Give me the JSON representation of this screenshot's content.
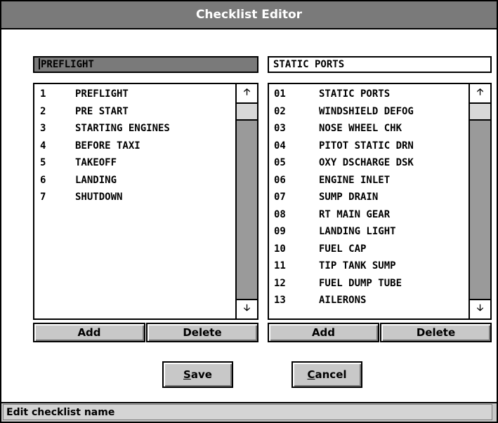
{
  "window": {
    "title": "Checklist Editor"
  },
  "left_panel": {
    "name_value": "PREFLIGHT",
    "items": [
      {
        "num": "1",
        "label": "PREFLIGHT"
      },
      {
        "num": "2",
        "label": "PRE START"
      },
      {
        "num": "3",
        "label": "STARTING ENGINES"
      },
      {
        "num": "4",
        "label": "BEFORE TAXI"
      },
      {
        "num": "5",
        "label": "TAKEOFF"
      },
      {
        "num": "6",
        "label": "LANDING"
      },
      {
        "num": "7",
        "label": "SHUTDOWN"
      }
    ],
    "add_label": "Add",
    "delete_label": "Delete"
  },
  "right_panel": {
    "name_value": "STATIC PORTS",
    "items": [
      {
        "num": "01",
        "label": "STATIC PORTS"
      },
      {
        "num": "02",
        "label": "WINDSHIELD DEFOG"
      },
      {
        "num": "03",
        "label": "NOSE WHEEL CHK"
      },
      {
        "num": "04",
        "label": "PITOT STATIC DRN"
      },
      {
        "num": "05",
        "label": "OXY DSCHARGE DSK"
      },
      {
        "num": "06",
        "label": "ENGINE INLET"
      },
      {
        "num": "07",
        "label": "SUMP DRAIN"
      },
      {
        "num": "08",
        "label": "RT MAIN GEAR"
      },
      {
        "num": "09",
        "label": "LANDING LIGHT"
      },
      {
        "num": "10",
        "label": "FUEL CAP"
      },
      {
        "num": "11",
        "label": "TIP TANK SUMP"
      },
      {
        "num": "12",
        "label": "FUEL DUMP TUBE"
      },
      {
        "num": "13",
        "label": "AILERONS"
      }
    ],
    "add_label": "Add",
    "delete_label": "Delete"
  },
  "footer": {
    "save_label_rest": "ave",
    "save_label_mnemonic": "S",
    "cancel_label_rest": "ancel",
    "cancel_label_mnemonic": "C"
  },
  "status": {
    "text": "Edit checklist name"
  },
  "icons": {
    "scroll_up": "arrow-up-icon",
    "scroll_down": "arrow-down-icon"
  }
}
